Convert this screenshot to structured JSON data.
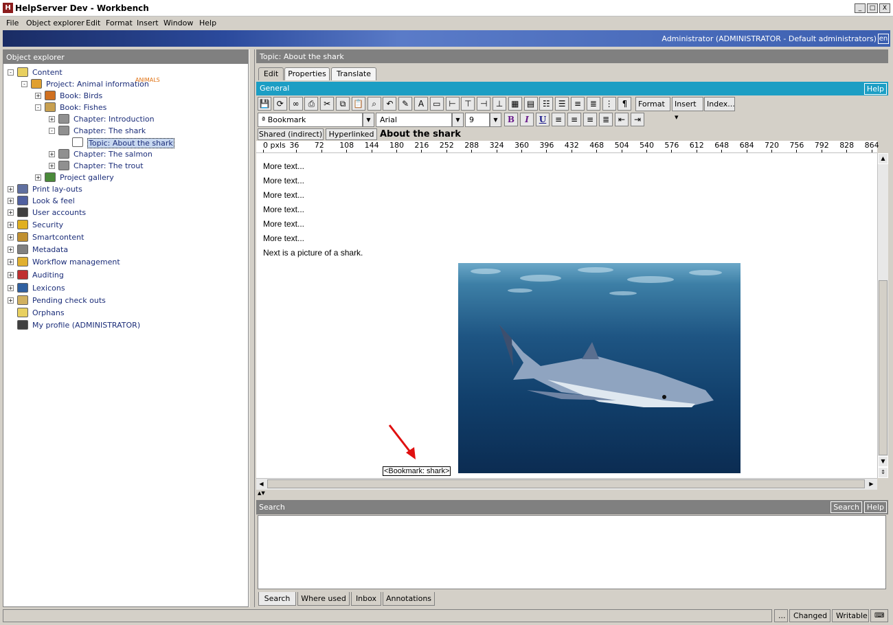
{
  "app_title": "HelpServer Dev - Workbench",
  "window_controls": {
    "minimize": "_",
    "maximize": "□",
    "close": "X"
  },
  "menu": [
    "File",
    "Object explorer",
    "Edit",
    "Format",
    "Insert",
    "Window",
    "Help"
  ],
  "banner": {
    "user": "Administrator (ADMINISTRATOR - Default administrators)",
    "lang": "en"
  },
  "object_explorer": {
    "title": "Object explorer",
    "tree": [
      {
        "label": "Content",
        "exp": "-",
        "icon_color": "#e8d060"
      },
      {
        "label": "Project: Animal information",
        "badge": "ANIMALS",
        "exp": "-",
        "icon_color": "#e0a030"
      },
      {
        "label": "Book: Birds",
        "exp": "+",
        "icon_color": "#d07020"
      },
      {
        "label": "Book: Fishes",
        "exp": "-",
        "icon_color": "#c8a050"
      },
      {
        "label": "Chapter: Introduction",
        "exp": "+",
        "icon_color": "#909090"
      },
      {
        "label": "Chapter: The shark",
        "exp": "-",
        "icon_color": "#909090"
      },
      {
        "label": "Topic: About the shark",
        "exp": "",
        "icon_color": "#ffffff",
        "selected": true
      },
      {
        "label": "Chapter: The salmon",
        "exp": "+",
        "icon_color": "#909090"
      },
      {
        "label": "Chapter: The trout",
        "exp": "+",
        "icon_color": "#909090"
      },
      {
        "label": "Project gallery",
        "exp": "+",
        "icon_color": "#4a8a3a"
      },
      {
        "label": "Print lay-outs",
        "exp": "+",
        "icon_color": "#6070a0"
      },
      {
        "label": "Look & feel",
        "exp": "+",
        "icon_color": "#5060a0"
      },
      {
        "label": "User accounts",
        "exp": "+",
        "icon_color": "#404040"
      },
      {
        "label": "Security",
        "exp": "+",
        "icon_color": "#e0b020"
      },
      {
        "label": "Smartcontent",
        "exp": "+",
        "icon_color": "#c09030"
      },
      {
        "label": "Metadata",
        "exp": "+",
        "icon_color": "#808080"
      },
      {
        "label": "Workflow management",
        "exp": "+",
        "icon_color": "#e0b030"
      },
      {
        "label": "Auditing",
        "exp": "+",
        "icon_color": "#c03030"
      },
      {
        "label": "Lexicons",
        "exp": "+",
        "icon_color": "#3060a0"
      },
      {
        "label": "Pending check outs",
        "exp": "+",
        "icon_color": "#d0b060"
      },
      {
        "label": "Orphans",
        "exp": "",
        "icon_color": "#e8d060"
      },
      {
        "label": "My profile (ADMINISTRATOR)",
        "exp": "",
        "icon_color": "#404040"
      }
    ]
  },
  "topic_header": "Topic: About the shark",
  "tabs": [
    "Edit",
    "Properties",
    "Translate"
  ],
  "general": {
    "title": "General",
    "help": "Help"
  },
  "toolbar": {
    "icons": [
      "save-icon",
      "refresh-icon",
      "spellcheck-icon",
      "print-icon",
      "cut-icon",
      "copy-icon",
      "paste-icon",
      "find-icon",
      "undo-icon",
      "highlight-icon",
      "style-icon",
      "frame-icon",
      "insert-row-icon",
      "insert-col-icon",
      "merge-icon",
      "split-icon",
      "table-a-icon",
      "table-b-icon",
      "numbered-list-icon",
      "bullet-list-icon",
      "list-a-icon",
      "list-b-icon",
      "list-c-icon",
      "paragraph-icon"
    ],
    "glyphs": [
      "💾",
      "⟳",
      "∞",
      "⎙",
      "✂",
      "⧉",
      "📋",
      "⌕",
      "↶",
      "✎",
      "A",
      "▭",
      "⊢",
      "⊤",
      "⊣",
      "⊥",
      "▦",
      "▤",
      "☷",
      "☰",
      "≡",
      "≣",
      "⋮",
      "¶"
    ],
    "format": "Format",
    "insert": "Insert",
    "index": "Index..."
  },
  "format_bar": {
    "style": "Bookmark",
    "font": "Arial",
    "size": "9",
    "bold": "B",
    "italic": "I",
    "underline": "U"
  },
  "links": {
    "shared": "Shared (indirect)",
    "hyperlinked": "Hyperlinked"
  },
  "topic_title": "About the shark",
  "ruler": [
    "0 pxls",
    "36",
    "72",
    "108",
    "144",
    "180",
    "216",
    "252",
    "288",
    "324",
    "360",
    "396",
    "432",
    "468",
    "504",
    "540",
    "576",
    "612",
    "648",
    "684",
    "720",
    "756",
    "792",
    "828",
    "864"
  ],
  "paragraphs": [
    "More text...",
    "More text...",
    "More text...",
    "More text...",
    "More text...",
    "More text...",
    "Next is a picture of a shark."
  ],
  "bookmark_tag": "<Bookmark: shark>",
  "search": {
    "title": "Search",
    "search_btn": "Search",
    "help": "Help"
  },
  "bottom_tabs": [
    "Search",
    "Where used",
    "Inbox",
    "Annotations"
  ],
  "status": {
    "dots": "...",
    "changed": "Changed",
    "writable": "Writable"
  }
}
